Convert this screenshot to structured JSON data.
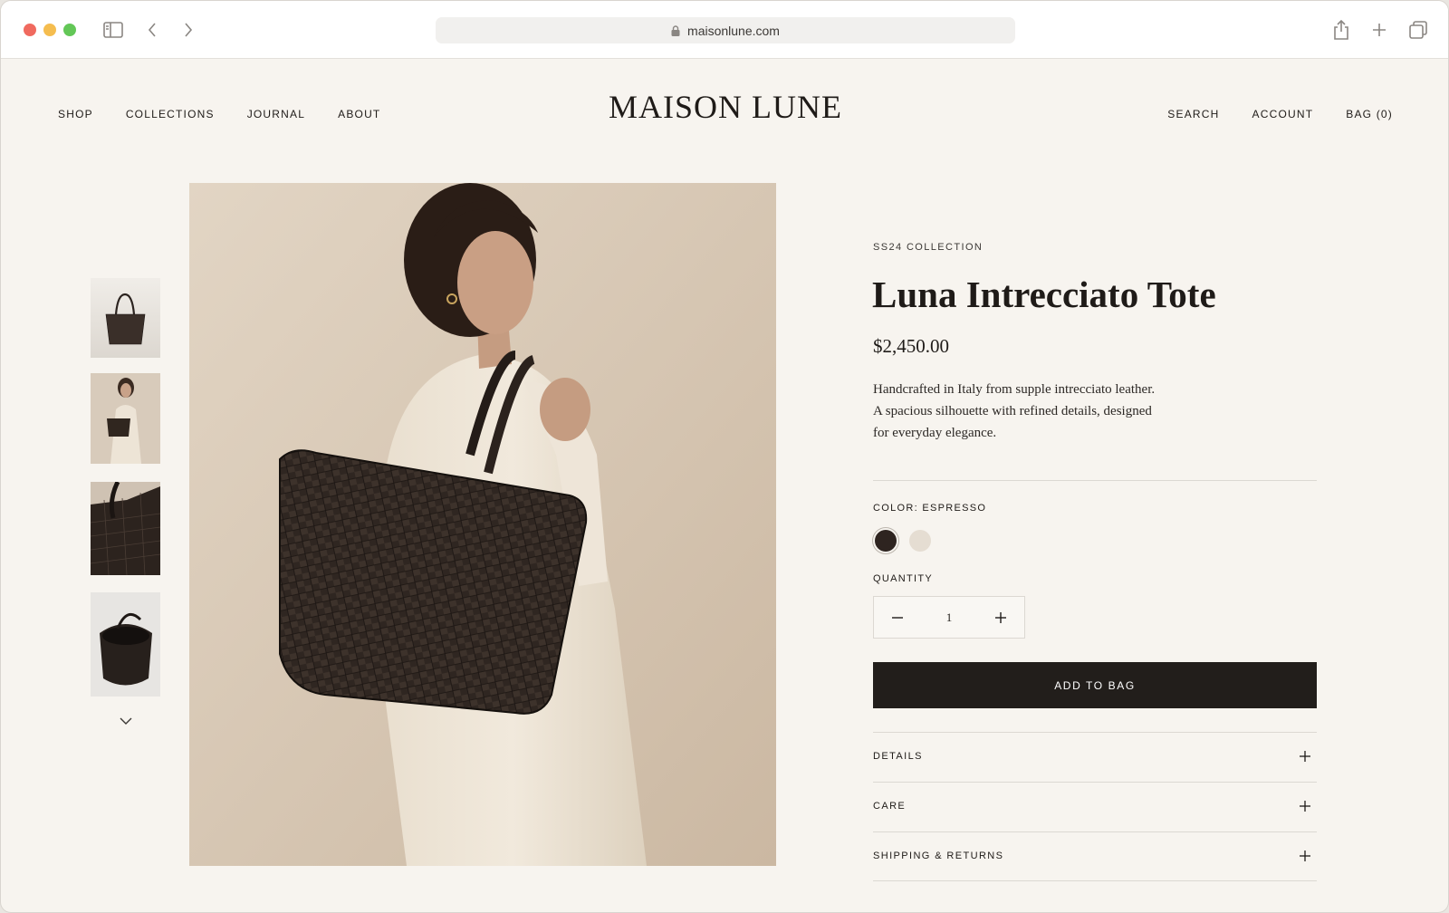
{
  "browser": {
    "url": "maisonlune.com",
    "icons": [
      "sidebar-icon",
      "back-icon",
      "forward-icon",
      "lock-icon",
      "share-icon",
      "new-tab-icon",
      "tabs-overview-icon"
    ]
  },
  "header": {
    "logo": "MAISON LUNE",
    "nav_left": [
      "SHOP",
      "COLLECTIONS",
      "JOURNAL",
      "ABOUT"
    ],
    "nav_right": [
      "SEARCH",
      "ACCOUNT",
      "BAG (0)"
    ]
  },
  "gallery": {
    "thumbnails": [
      "tote-product-front",
      "model-wearing-tote",
      "tote-weave-closeup",
      "tote-interior-view"
    ],
    "next_icon": "chevron-down-icon"
  },
  "product": {
    "collection": "SS24 COLLECTION",
    "name": "Luna Intrecciato Tote",
    "price": "$2,450.00",
    "description_lines": [
      "Handcrafted in Italy from supple intrecciato leather.",
      "A spacious silhouette with refined details, designed",
      "for everyday elegance."
    ],
    "color_label": "COLOR: ESPRESSO",
    "swatches": [
      {
        "name": "espresso",
        "hex": "#2e2420",
        "selected": true
      },
      {
        "name": "cream",
        "hex": "#e5ddd2",
        "selected": false
      }
    ],
    "quantity_label": "QUANTITY",
    "quantity": "1",
    "add_to_bag": "ADD TO BAG",
    "accordion": [
      "DETAILS",
      "CARE",
      "SHIPPING & RETURNS"
    ]
  },
  "colors": {
    "page_bg": "#f7f4ef",
    "button_bg": "#221e1b",
    "text": "#1f1b18"
  }
}
